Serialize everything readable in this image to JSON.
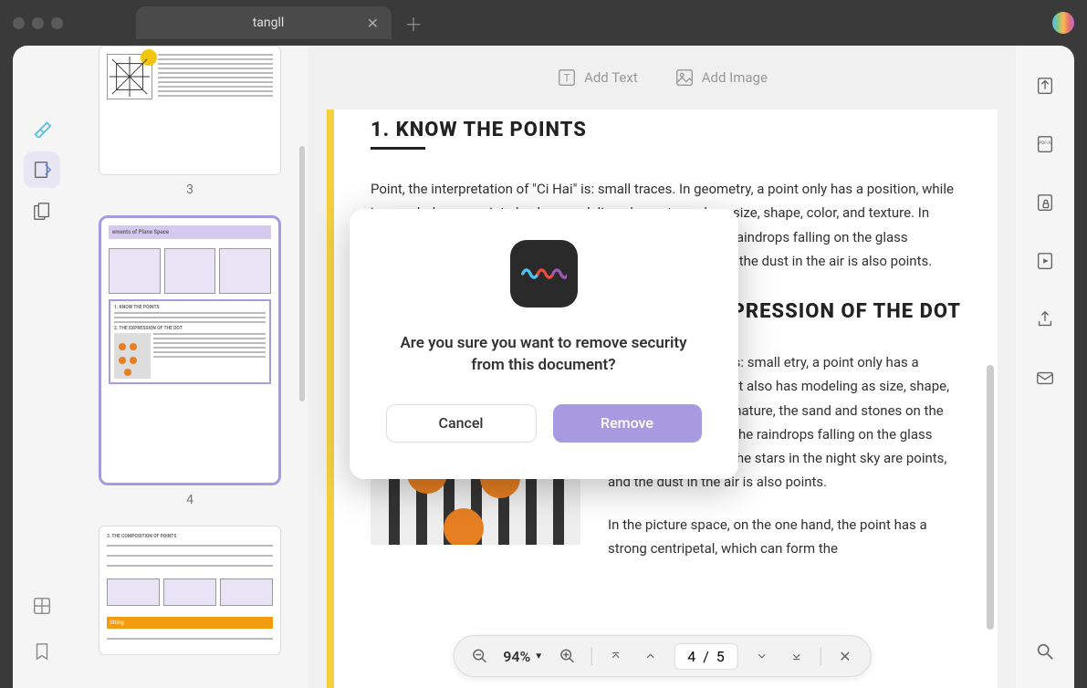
{
  "tab": {
    "title": "tangll"
  },
  "toolbar": {
    "add_text": "Add Text",
    "add_image": "Add Image"
  },
  "thumbnails": {
    "page3_num": "3",
    "page4_num": "4",
    "page4_header": "ements of Plane Space",
    "page5_string": "String"
  },
  "doc": {
    "h1": "1. KNOW THE POINTS",
    "p1": "Point, the interpretation of \"Ci Hai\" is: small traces. In geometry, a point only has a position, while in morphology, a point also has modeling elements such as size, shape, color, and texture. In nature, the sand and stones on the seashore are points, the raindrops falling on the glass windows are points, the stars in the night sky are points, and the dust in the air is also points.",
    "h2_partial": "PRESSION OF THE DOT",
    "p2_partial_a": "pretation of \"Ci Hai\" is: small etry, a point only has a position, ology, a point also has modeling as size, shape, color, and texture. In nature, the sand and stones on the seashore are points, the raindrops falling on the glass windows are points, the stars in the night sky are points, and the dust in the air is also points.",
    "p3_partial": "In the picture space, on the one hand, the point has a strong centripetal, which can form the"
  },
  "bottom": {
    "zoom": "94%",
    "page_current": "4",
    "page_sep": "/",
    "page_total": "5"
  },
  "modal": {
    "message": "Are you sure you want to remove security from this document?",
    "cancel": "Cancel",
    "remove": "Remove"
  }
}
